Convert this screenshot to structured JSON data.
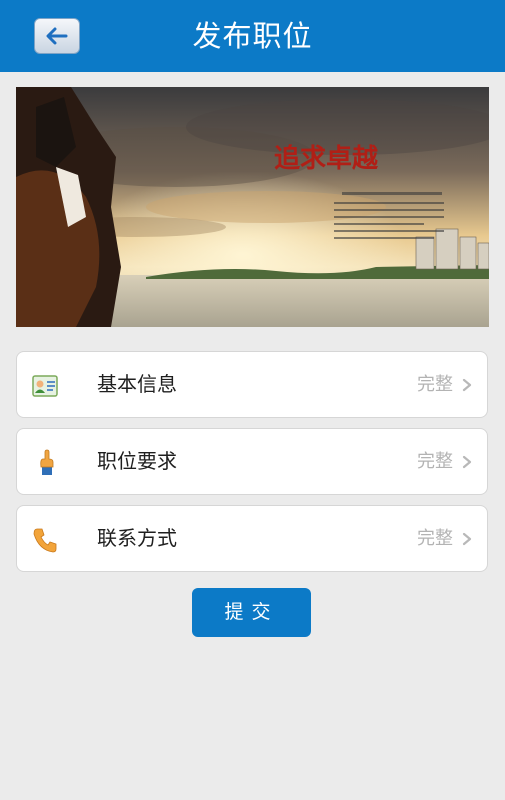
{
  "header": {
    "title": "发布职位",
    "back_icon": "arrow-left-icon",
    "color": "#0c7ac7"
  },
  "banner": {
    "slogan": "追求卓越"
  },
  "sections": [
    {
      "icon": "id-card-icon",
      "label": "基本信息",
      "status": "完整"
    },
    {
      "icon": "pointing-hand-icon",
      "label": "职位要求",
      "status": "完整"
    },
    {
      "icon": "phone-icon",
      "label": "联系方式",
      "status": "完整"
    }
  ],
  "submit": {
    "label": "提交"
  }
}
